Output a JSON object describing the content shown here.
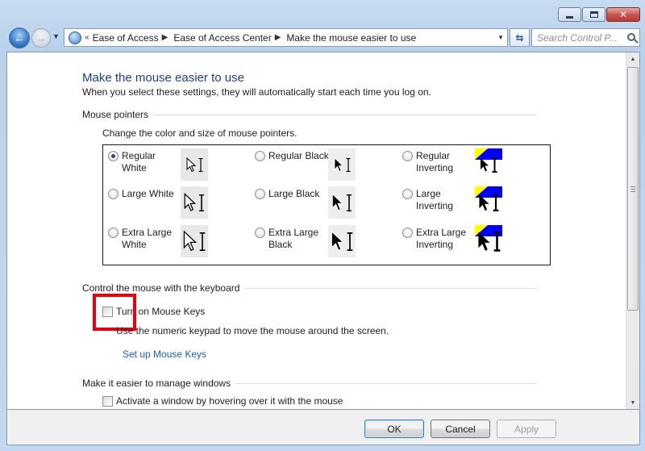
{
  "nav": {
    "breadcrumb": [
      "Ease of Access",
      "Ease of Access Center",
      "Make the mouse easier to use"
    ],
    "search_placeholder": "Search Control P..."
  },
  "page": {
    "title": "Make the mouse easier to use",
    "subtitle": "When you select these settings, they will automatically start each time you log on."
  },
  "pointers": {
    "heading": "Mouse pointers",
    "help": "Change the color and size of mouse pointers.",
    "schemes": [
      {
        "label": "Regular White",
        "checked": true
      },
      {
        "label": "Regular Black",
        "checked": false
      },
      {
        "label": "Regular Inverting",
        "checked": false
      },
      {
        "label": "Large White",
        "checked": false
      },
      {
        "label": "Large Black",
        "checked": false
      },
      {
        "label": "Large Inverting",
        "checked": false
      },
      {
        "label": "Extra Large White",
        "checked": false
      },
      {
        "label": "Extra Large Black",
        "checked": false
      },
      {
        "label": "Extra Large Inverting",
        "checked": false
      }
    ]
  },
  "keyboard": {
    "heading": "Control the mouse with the keyboard",
    "mouse_keys_label": "Turn on Mouse Keys",
    "mouse_keys_checked": false,
    "description": "Use the numeric keypad to move the mouse around the screen.",
    "setup_link": "Set up Mouse Keys"
  },
  "windows": {
    "heading": "Make it easier to manage windows",
    "hover_label": "Activate a window by hovering over it with the mouse",
    "hover_checked": false
  },
  "buttons": {
    "ok": "OK",
    "cancel": "Cancel",
    "apply": "Apply"
  },
  "colors": {
    "title": "#1e3f8c",
    "link": "#1c5fb6",
    "highlight": "#e8000d",
    "invert_blue": "#0000ff",
    "invert_yellow": "#ffff00"
  }
}
